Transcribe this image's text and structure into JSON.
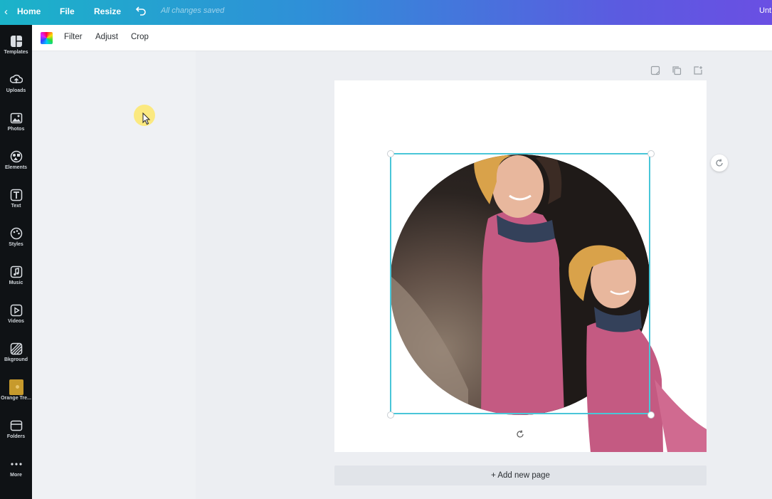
{
  "topbar": {
    "home_label": "Home",
    "file_label": "File",
    "resize_label": "Resize",
    "saved_status": "All changes saved",
    "design_title": "Unt"
  },
  "sidebar": {
    "items": [
      {
        "label": "Templates",
        "icon": "templates-icon"
      },
      {
        "label": "Uploads",
        "icon": "upload-icon"
      },
      {
        "label": "Photos",
        "icon": "photo-icon"
      },
      {
        "label": "Elements",
        "icon": "elements-icon"
      },
      {
        "label": "Text",
        "icon": "text-icon"
      },
      {
        "label": "Styles",
        "icon": "palette-icon"
      },
      {
        "label": "Music",
        "icon": "music-icon"
      },
      {
        "label": "Videos",
        "icon": "video-icon"
      },
      {
        "label": "Bkground",
        "icon": "background-icon"
      },
      {
        "label": "Orange Tre...",
        "icon": "folder-thumbnail-icon"
      },
      {
        "label": "Folders",
        "icon": "folder-icon"
      },
      {
        "label": "More",
        "icon": "more-icon"
      }
    ]
  },
  "toolbar": {
    "filter_label": "Filter",
    "adjust_label": "Adjust",
    "crop_label": "Crop"
  },
  "canvas": {
    "add_page_label": "+ Add new page"
  },
  "colors": {
    "accent": "#49c6d8",
    "rail_bg": "#0f1215",
    "sweater": "#c45a82",
    "hat": "#d9a24a"
  }
}
